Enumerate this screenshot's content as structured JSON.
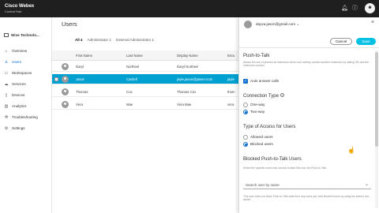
{
  "header": {
    "brand_name": "Cisco Webex",
    "brand_sub": "Control Hub",
    "bell_icon": "bell-icon",
    "help_icon": "help-icon",
    "avatar_initials": "☻"
  },
  "sidebar": {
    "org_name": "Wise Technolo...",
    "items": [
      {
        "label": "Overview",
        "icon": "home-icon"
      },
      {
        "label": "Users",
        "icon": "person-icon"
      },
      {
        "label": "Workspaces",
        "icon": "workspace-icon"
      },
      {
        "label": "Services",
        "icon": "cloud-icon"
      },
      {
        "label": "Devices",
        "icon": "device-icon"
      },
      {
        "label": "Analytics",
        "icon": "chart-icon"
      },
      {
        "label": "Troubleshooting",
        "icon": "wrench-icon"
      },
      {
        "label": "Settings",
        "icon": "gear-icon"
      }
    ],
    "active_index": 1
  },
  "main": {
    "title": "Users",
    "tabs": [
      "All 4",
      "Administrator 1",
      "External Administrator 1"
    ],
    "columns": [
      "First Name",
      "Last Name",
      "Display Name",
      "Ema"
    ],
    "rows": [
      {
        "first": "Daryl",
        "last": "Northeel",
        "display": "Daryl Northeel",
        "email": "...",
        "selected": false
      },
      {
        "first": "Jason",
        "last": "Cardell",
        "display": "jayle.jason@jasser.com",
        "email": "jayle",
        "selected": true
      },
      {
        "first": "Thomas",
        "last": "Cox",
        "display": "Thomas Cox",
        "email": "thom",
        "selected": false
      },
      {
        "first": "Vera",
        "last": "Mae",
        "display": "Vera Mae",
        "email": "vera",
        "selected": false
      }
    ]
  },
  "panel": {
    "email": "dayva.jason@gmail.com ⌄",
    "close_label": "×",
    "cancel_label": "Cancel",
    "save_label": "Save",
    "ptt_title": "Push-to-Talk",
    "ptt_desc": "Allows the use of phones as intercoms which can overlay contact another extension by dialing *83 and the extension number.",
    "auto_answer_label": "Auto answer calls",
    "auto_answer_checked": true,
    "conn_title": "Connection Type",
    "conn_options": [
      "One-way",
      "Two-way"
    ],
    "conn_selected": 1,
    "access_title": "Type of Access for Users",
    "access_options": [
      "Allowed users",
      "Blocked users"
    ],
    "access_selected": 1,
    "blocked_title": "Blocked Push-to-Talk Users",
    "blocked_desc": "Select the specific users that cannot contact this user via Push-to-Talk.",
    "search_placeholder": "Search user by name",
    "footer_desc": "This user does not block Push-to-Talk calls from any users yet. Add blocked users by using the search box above."
  },
  "colors": {
    "topbar": "#1f1f1f",
    "selected_row": "#00a0d1",
    "save_button": "#07c1e4",
    "accent": "#1170cf"
  }
}
